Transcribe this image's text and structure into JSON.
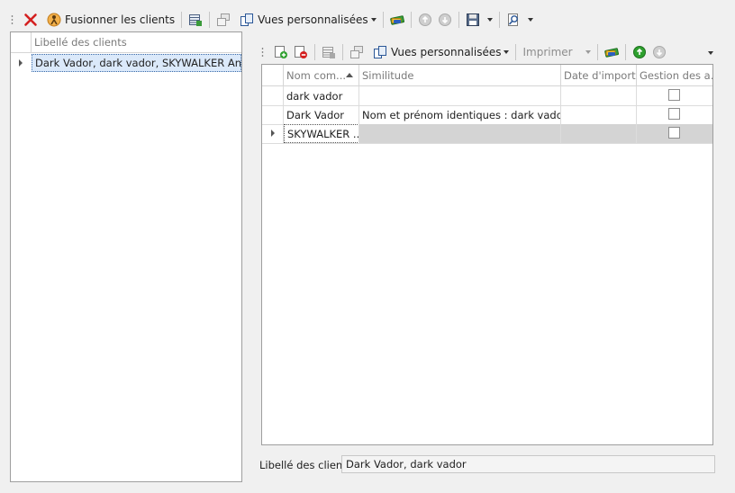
{
  "toolbar": {
    "merge_label": "Fusionner les clients",
    "views_label": "Vues personnalisées"
  },
  "left": {
    "header": "Libellé des clients",
    "rows": [
      {
        "label": "Dark Vador, dark vador, SKYWALKER Anakin"
      }
    ]
  },
  "right_toolbar": {
    "views_label": "Vues personnalisées",
    "print_label": "Imprimer"
  },
  "grid": {
    "columns": [
      "Nom com...",
      "Similitude",
      "Date d'import",
      "Gestion des a..."
    ],
    "rows": [
      {
        "name": "dark vador",
        "similitude": "",
        "date": "",
        "checked": false
      },
      {
        "name": "Dark Vador",
        "similitude": "Nom et prénom identiques : dark vador",
        "date": "",
        "checked": false
      },
      {
        "name": "SKYWALKER ...",
        "similitude": "",
        "date": "",
        "checked": false
      }
    ]
  },
  "footer": {
    "label": "Libellé des clients:",
    "value": "Dark Vador, dark vador"
  },
  "colors": {
    "delete_red": "#d42020",
    "selection_bg": "#dbe9fa",
    "selected_row_bg": "#d4d4d4"
  }
}
